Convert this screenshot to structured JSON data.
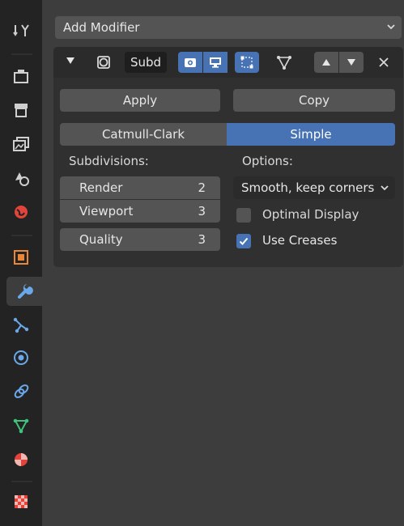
{
  "panel": {
    "add_modifier_label": "Add Modifier"
  },
  "modifier": {
    "name": "Subd",
    "apply_label": "Apply",
    "copy_label": "Copy",
    "algorithm_options": [
      "Catmull-Clark",
      "Simple"
    ],
    "algorithm_selected": "Simple",
    "subdivisions_heading": "Subdivisions:",
    "options_heading": "Options:",
    "render_label": "Render",
    "render_value": "2",
    "viewport_label": "Viewport",
    "viewport_value": "3",
    "quality_label": "Quality",
    "quality_value": "3",
    "uv_smooth_value": "Smooth, keep corners",
    "optimal_display_label": "Optimal Display",
    "optimal_display_checked": false,
    "use_creases_label": "Use Creases",
    "use_creases_checked": true
  },
  "tabs": [
    {
      "name": "tool-icon",
      "active": false
    },
    {
      "name": "render-icon",
      "active": false
    },
    {
      "name": "output-icon",
      "active": false
    },
    {
      "name": "view-layer-icon",
      "active": false
    },
    {
      "name": "scene-icon",
      "active": false
    },
    {
      "name": "world-icon",
      "active": false
    },
    {
      "name": "object-icon",
      "active": false
    },
    {
      "name": "modifier-wrench-icon",
      "active": true
    },
    {
      "name": "particles-icon",
      "active": false
    },
    {
      "name": "physics-icon",
      "active": false
    },
    {
      "name": "constraints-icon",
      "active": false
    },
    {
      "name": "object-data-icon",
      "active": false
    },
    {
      "name": "material-icon",
      "active": false
    },
    {
      "name": "texture-icon",
      "active": false
    }
  ],
  "colors": {
    "accent": "#4772b3",
    "panel_bg": "#3d3d3d",
    "sidebar_bg": "#232323"
  }
}
